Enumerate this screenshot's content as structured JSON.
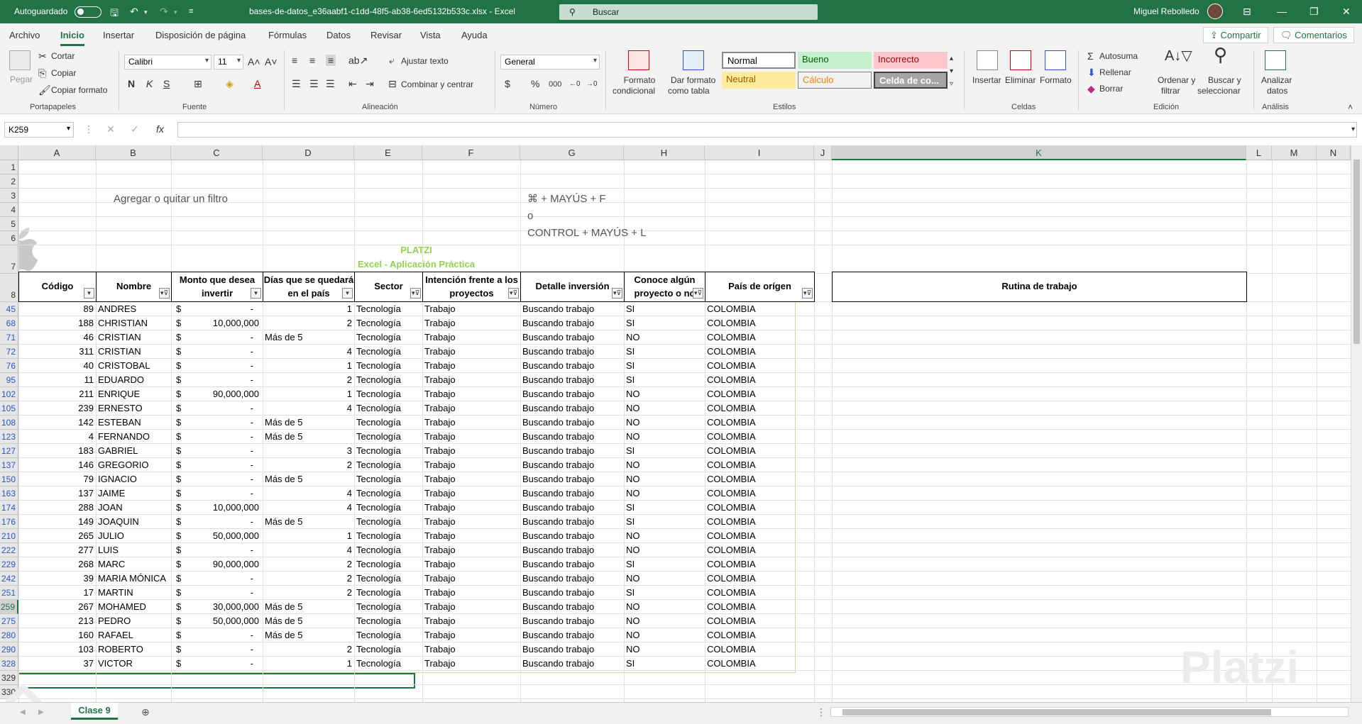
{
  "titlebar": {
    "autosave": "Autoguardado",
    "filename": "bases-de-datos_e36aabf1-c1dd-48f5-ab38-6ed5132b533c.xlsx - Excel",
    "search_placeholder": "Buscar",
    "user": "Miguel Rebolledo"
  },
  "menu": {
    "tabs": [
      "Archivo",
      "Inicio",
      "Insertar",
      "Disposición de página",
      "Fórmulas",
      "Datos",
      "Revisar",
      "Vista",
      "Ayuda"
    ],
    "active": "Inicio",
    "share": "Compartir",
    "comments": "Comentarios"
  },
  "ribbon": {
    "clipboard": {
      "paste": "Pegar",
      "cut": "Cortar",
      "copy": "Copiar",
      "copy_format": "Copiar formato",
      "label": "Portapapeles"
    },
    "font": {
      "name": "Calibri",
      "size": "11",
      "bold": "N",
      "italic": "K",
      "underline": "S",
      "label": "Fuente"
    },
    "alignment": {
      "wrap": "Ajustar texto",
      "merge": "Combinar y centrar",
      "label": "Alineación"
    },
    "number": {
      "format": "General",
      "currency": "$",
      "percent": "%",
      "label": "Número"
    },
    "styles": {
      "cond_format_1": "Formato",
      "cond_format_2": "condicional",
      "table_format_1": "Dar formato",
      "table_format_2": "como tabla",
      "normal": "Normal",
      "bueno": "Bueno",
      "incorrecto": "Incorrecto",
      "neutral": "Neutral",
      "calculo": "Cálculo",
      "celda": "Celda de co...",
      "label": "Estilos"
    },
    "cells": {
      "insert": "Insertar",
      "delete": "Eliminar",
      "format": "Formato",
      "label": "Celdas"
    },
    "editing": {
      "autosum": "Autosuma",
      "fill": "Rellenar",
      "clear": "Borrar",
      "sort_1": "Ordenar y",
      "sort_2": "filtrar",
      "find_1": "Buscar y",
      "find_2": "seleccionar",
      "label": "Edición"
    },
    "analysis": {
      "analyze_1": "Analizar",
      "analyze_2": "datos",
      "label": "Análisis"
    }
  },
  "formula_bar": {
    "name_box": "K259",
    "fx": "fx",
    "value": ""
  },
  "columns": [
    "A",
    "B",
    "C",
    "D",
    "E",
    "F",
    "G",
    "H",
    "I",
    "J",
    "K",
    "L",
    "M",
    "N"
  ],
  "selected_column": "K",
  "overlay": {
    "filter_text": "Agregar o quitar un filtro",
    "shortcut_1": "⌘ + MAYÚS + F",
    "shortcut_or": "o",
    "shortcut_2": "CONTROL + MAYÚS + L"
  },
  "title": {
    "line1": "PLATZI",
    "line2": "Excel - Aplicación Práctica"
  },
  "headers": {
    "a": "Código",
    "b": "Nombre",
    "c1": "Monto que desea",
    "c2": "invertir",
    "d1": "Días que se quedará",
    "d2": "en el país",
    "e": "Sector",
    "f1": "Intención frente a los",
    "f2": "proyectos",
    "g": "Detalle inversión",
    "h1": "Conoce algún",
    "h2": "proyecto o no",
    "i": "País de orígen",
    "k": "Rutina de trabajo"
  },
  "rows": [
    {
      "rn": "45",
      "code": "89",
      "name": "ANDRES",
      "amt": "-",
      "days": "1",
      "sector": "Tecnología",
      "intent": "Trabajo",
      "detail": "Buscando trabajo",
      "know": "SI",
      "country": "COLOMBIA"
    },
    {
      "rn": "68",
      "code": "188",
      "name": "CHRISTIAN",
      "amt": "10,000,000",
      "days": "2",
      "sector": "Tecnología",
      "intent": "Trabajo",
      "detail": "Buscando trabajo",
      "know": "SI",
      "country": "COLOMBIA"
    },
    {
      "rn": "71",
      "code": "46",
      "name": "CRISTIAN",
      "amt": "-",
      "days": "Más de 5",
      "sector": "Tecnología",
      "intent": "Trabajo",
      "detail": "Buscando trabajo",
      "know": "NO",
      "country": "COLOMBIA"
    },
    {
      "rn": "72",
      "code": "311",
      "name": "CRISTIAN",
      "amt": "-",
      "days": "4",
      "sector": "Tecnología",
      "intent": "Trabajo",
      "detail": "Buscando trabajo",
      "know": "SI",
      "country": "COLOMBIA"
    },
    {
      "rn": "76",
      "code": "40",
      "name": "CRISTOBAL",
      "amt": "-",
      "days": "1",
      "sector": "Tecnología",
      "intent": "Trabajo",
      "detail": "Buscando trabajo",
      "know": "SI",
      "country": "COLOMBIA"
    },
    {
      "rn": "95",
      "code": "11",
      "name": "EDUARDO",
      "amt": "-",
      "days": "2",
      "sector": "Tecnología",
      "intent": "Trabajo",
      "detail": "Buscando trabajo",
      "know": "SI",
      "country": "COLOMBIA"
    },
    {
      "rn": "102",
      "code": "211",
      "name": "ENRIQUE",
      "amt": "90,000,000",
      "days": "1",
      "sector": "Tecnología",
      "intent": "Trabajo",
      "detail": "Buscando trabajo",
      "know": "NO",
      "country": "COLOMBIA"
    },
    {
      "rn": "105",
      "code": "239",
      "name": "ERNESTO",
      "amt": "-",
      "days": "4",
      "sector": "Tecnología",
      "intent": "Trabajo",
      "detail": "Buscando trabajo",
      "know": "NO",
      "country": "COLOMBIA"
    },
    {
      "rn": "108",
      "code": "142",
      "name": "ESTEBAN",
      "amt": "-",
      "days": "Más de 5",
      "sector": "Tecnología",
      "intent": "Trabajo",
      "detail": "Buscando trabajo",
      "know": "NO",
      "country": "COLOMBIA"
    },
    {
      "rn": "123",
      "code": "4",
      "name": "FERNANDO",
      "amt": "-",
      "days": "Más de 5",
      "sector": "Tecnología",
      "intent": "Trabajo",
      "detail": "Buscando trabajo",
      "know": "NO",
      "country": "COLOMBIA"
    },
    {
      "rn": "127",
      "code": "183",
      "name": "GABRIEL",
      "amt": "-",
      "days": "3",
      "sector": "Tecnología",
      "intent": "Trabajo",
      "detail": "Buscando trabajo",
      "know": "SI",
      "country": "COLOMBIA"
    },
    {
      "rn": "137",
      "code": "146",
      "name": "GREGORIO",
      "amt": "-",
      "days": "2",
      "sector": "Tecnología",
      "intent": "Trabajo",
      "detail": "Buscando trabajo",
      "know": "NO",
      "country": "COLOMBIA"
    },
    {
      "rn": "150",
      "code": "79",
      "name": "IGNACIO",
      "amt": "-",
      "days": "Más de 5",
      "sector": "Tecnología",
      "intent": "Trabajo",
      "detail": "Buscando trabajo",
      "know": "NO",
      "country": "COLOMBIA"
    },
    {
      "rn": "163",
      "code": "137",
      "name": "JAIME",
      "amt": "-",
      "days": "4",
      "sector": "Tecnología",
      "intent": "Trabajo",
      "detail": "Buscando trabajo",
      "know": "NO",
      "country": "COLOMBIA"
    },
    {
      "rn": "174",
      "code": "288",
      "name": "JOAN",
      "amt": "10,000,000",
      "days": "4",
      "sector": "Tecnología",
      "intent": "Trabajo",
      "detail": "Buscando trabajo",
      "know": "SI",
      "country": "COLOMBIA"
    },
    {
      "rn": "176",
      "code": "149",
      "name": "JOAQUIN",
      "amt": "-",
      "days": "Más de 5",
      "sector": "Tecnología",
      "intent": "Trabajo",
      "detail": "Buscando trabajo",
      "know": "SI",
      "country": "COLOMBIA"
    },
    {
      "rn": "210",
      "code": "265",
      "name": "JULIO",
      "amt": "50,000,000",
      "days": "1",
      "sector": "Tecnología",
      "intent": "Trabajo",
      "detail": "Buscando trabajo",
      "know": "NO",
      "country": "COLOMBIA"
    },
    {
      "rn": "222",
      "code": "277",
      "name": "LUIS",
      "amt": "-",
      "days": "4",
      "sector": "Tecnología",
      "intent": "Trabajo",
      "detail": "Buscando trabajo",
      "know": "NO",
      "country": "COLOMBIA"
    },
    {
      "rn": "229",
      "code": "268",
      "name": "MARC",
      "amt": "90,000,000",
      "days": "2",
      "sector": "Tecnología",
      "intent": "Trabajo",
      "detail": "Buscando trabajo",
      "know": "SI",
      "country": "COLOMBIA"
    },
    {
      "rn": "242",
      "code": "39",
      "name": "MARIA MÓNICA",
      "amt": "-",
      "days": "2",
      "sector": "Tecnología",
      "intent": "Trabajo",
      "detail": "Buscando trabajo",
      "know": "NO",
      "country": "COLOMBIA"
    },
    {
      "rn": "251",
      "code": "17",
      "name": "MARTIN",
      "amt": "-",
      "days": "2",
      "sector": "Tecnología",
      "intent": "Trabajo",
      "detail": "Buscando trabajo",
      "know": "SI",
      "country": "COLOMBIA"
    },
    {
      "rn": "259",
      "code": "267",
      "name": "MOHAMED",
      "amt": "30,000,000",
      "days": "Más de 5",
      "sector": "Tecnología",
      "intent": "Trabajo",
      "detail": "Buscando trabajo",
      "know": "NO",
      "country": "COLOMBIA"
    },
    {
      "rn": "275",
      "code": "213",
      "name": "PEDRO",
      "amt": "50,000,000",
      "days": "Más de 5",
      "sector": "Tecnología",
      "intent": "Trabajo",
      "detail": "Buscando trabajo",
      "know": "NO",
      "country": "COLOMBIA"
    },
    {
      "rn": "280",
      "code": "160",
      "name": "RAFAEL",
      "amt": "-",
      "days": "Más de 5",
      "sector": "Tecnología",
      "intent": "Trabajo",
      "detail": "Buscando trabajo",
      "know": "NO",
      "country": "COLOMBIA"
    },
    {
      "rn": "290",
      "code": "103",
      "name": "ROBERTO",
      "amt": "-",
      "days": "2",
      "sector": "Tecnología",
      "intent": "Trabajo",
      "detail": "Buscando trabajo",
      "know": "NO",
      "country": "COLOMBIA"
    },
    {
      "rn": "328",
      "code": "37",
      "name": "VICTOR",
      "amt": "-",
      "days": "1",
      "sector": "Tecnología",
      "intent": "Trabajo",
      "detail": "Buscando trabajo",
      "know": "SI",
      "country": "COLOMBIA"
    }
  ],
  "trailing_rows": [
    "329",
    "330"
  ],
  "top_rows": [
    "1",
    "2",
    "3",
    "4",
    "5",
    "6",
    "7",
    "8"
  ],
  "currency_symbol": "$",
  "selected_row": "259",
  "sheet_tab": "Clase 9",
  "watermark": "Platzi",
  "colors": {
    "excel_green": "#217346",
    "title_green": "#92d050"
  }
}
